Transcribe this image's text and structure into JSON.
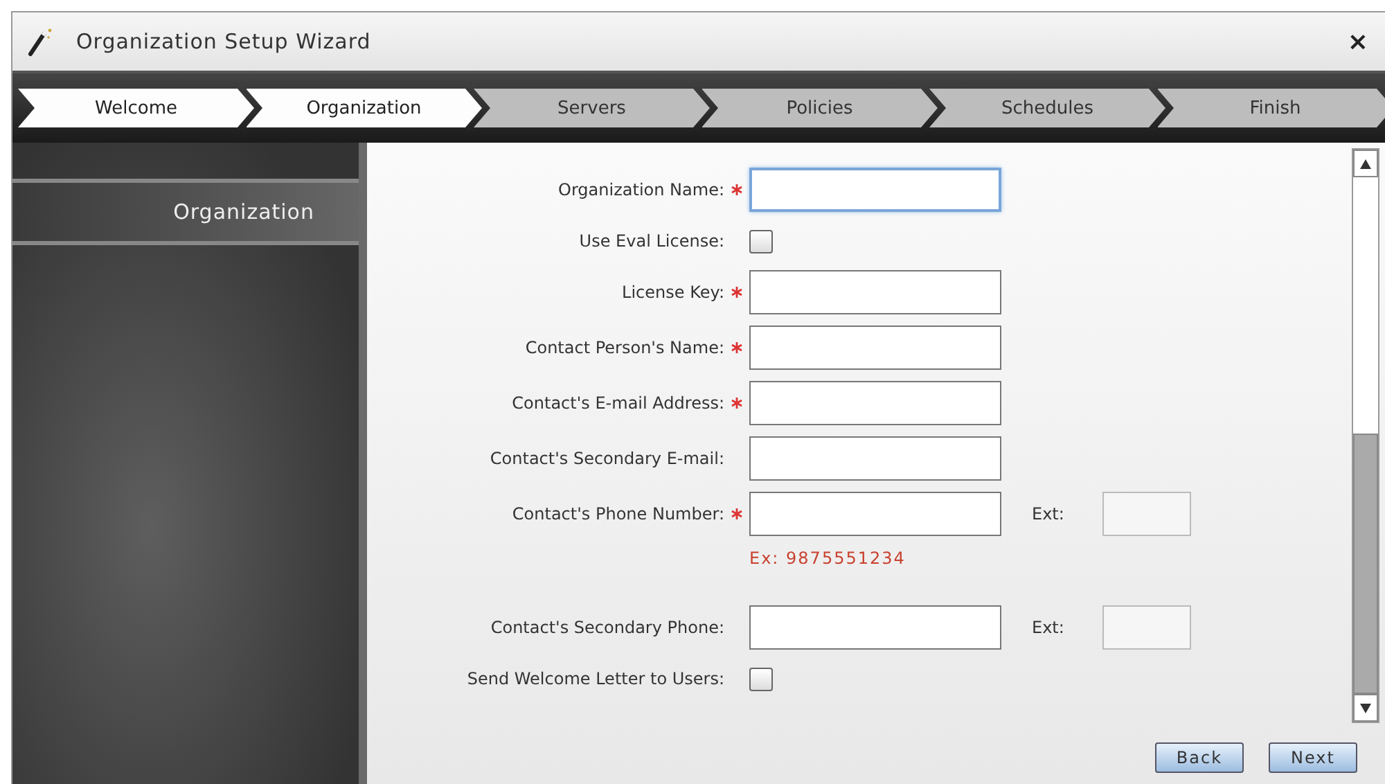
{
  "window": {
    "title": "Organization Setup Wizard",
    "close": "×"
  },
  "steps": [
    {
      "label": "Welcome",
      "reached": true
    },
    {
      "label": "Organization",
      "reached": true
    },
    {
      "label": "Servers",
      "reached": false
    },
    {
      "label": "Policies",
      "reached": false
    },
    {
      "label": "Schedules",
      "reached": false
    },
    {
      "label": "Finish",
      "reached": false
    }
  ],
  "sidebar": {
    "items": [
      {
        "label": "Organization",
        "selected": true
      }
    ]
  },
  "form": {
    "rows": [
      {
        "kind": "text",
        "label": "Organization Name:",
        "required": true,
        "focused": true
      },
      {
        "kind": "checkbox",
        "label": "Use Eval License:",
        "checked": false
      },
      {
        "kind": "text",
        "label": "License Key:",
        "required": true,
        "focused": false
      },
      {
        "kind": "text",
        "label": "Contact Person's Name:",
        "required": true,
        "focused": false
      },
      {
        "kind": "text",
        "label": "Contact's E-mail Address:",
        "required": true,
        "focused": false
      },
      {
        "kind": "text",
        "label": "Contact's Secondary E-mail:",
        "required": false,
        "focused": false
      },
      {
        "kind": "text",
        "label": "Contact's Phone Number:",
        "required": true,
        "focused": false,
        "ext_label": "Ext:"
      },
      {
        "kind": "hint",
        "text": "Ex: 9875551234"
      },
      {
        "kind": "text",
        "label": "Contact's Secondary Phone:",
        "required": false,
        "focused": false,
        "ext_label": "Ext:"
      },
      {
        "kind": "checkbox",
        "label": "Send Welcome Letter to Users:",
        "checked": false
      }
    ]
  },
  "buttons": [
    "Back",
    "Next"
  ]
}
